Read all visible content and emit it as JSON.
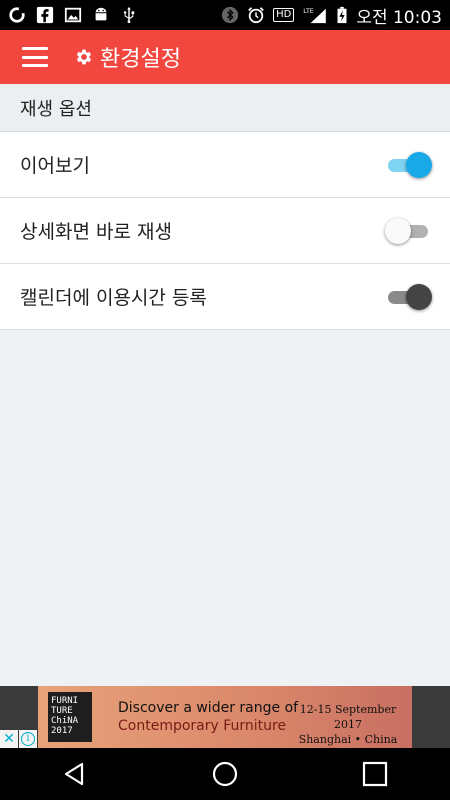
{
  "status_bar": {
    "left_icons": [
      "opera-icon",
      "facebook-icon",
      "image-icon",
      "android-icon",
      "usb-icon"
    ],
    "right_icons": [
      "bluetooth-icon",
      "alarm-icon",
      "hd-icon",
      "lte-signal-icon",
      "battery-charging-icon"
    ],
    "hd_label": "HD",
    "lte_label": "LTE",
    "time": "오전 10:03"
  },
  "app_bar": {
    "title": "환경설정",
    "menu_icon": "hamburger-menu-icon",
    "title_icon": "gear-icon",
    "color": "#f2473f"
  },
  "section": {
    "title": "재생 옵션"
  },
  "settings": [
    {
      "label": "이어보기",
      "state": "on"
    },
    {
      "label": "상세화면 바로 재생",
      "state": "off"
    },
    {
      "label": "캘린더에 이용시간 등록",
      "state": "off"
    }
  ],
  "ad": {
    "logo_lines": [
      "FURNI",
      "TURE",
      "ChiNA",
      "2017"
    ],
    "headline": "Discover a wider range of",
    "subline": "Contemporary Furniture",
    "dates": "12-15 September 2017",
    "location": "Shanghai • China",
    "close_symbol": "✕",
    "info_symbol": "i"
  },
  "nav_bar": {
    "buttons": [
      "back-icon",
      "home-icon",
      "recents-icon"
    ]
  }
}
